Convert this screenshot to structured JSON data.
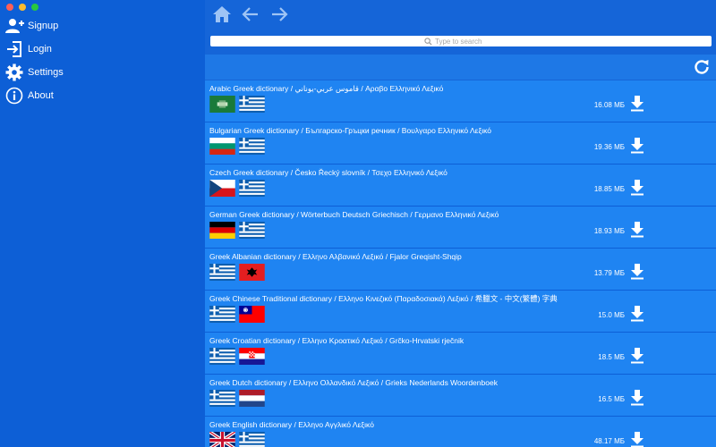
{
  "sidebar": {
    "items": [
      {
        "label": "Signup",
        "icon": "add-user-icon"
      },
      {
        "label": "Login",
        "icon": "login-icon"
      },
      {
        "label": "Settings",
        "icon": "gear-icon"
      },
      {
        "label": "About",
        "icon": "info-icon"
      }
    ]
  },
  "search": {
    "placeholder": "Type to search"
  },
  "dictionaries": [
    {
      "title": "Arabic Greek dictionary / قاموس عربي-يوناني / Αραβο Ελληνικό Λεξικό",
      "size": "16.08 МБ",
      "flags": [
        "saudi-arabia",
        "greece"
      ]
    },
    {
      "title": "Bulgarian Greek dictionary / Българско-Гръцки речник / Βουλγαρο Ελληνικό Λεξικό",
      "size": "19.36 МБ",
      "flags": [
        "bulgaria",
        "greece"
      ]
    },
    {
      "title": "Czech Greek dictionary / Česko Řecký slovník / Τσεχο Ελληνικό Λεξικό",
      "size": "18.85 МБ",
      "flags": [
        "czech-republic",
        "greece"
      ]
    },
    {
      "title": "German Greek dictionary / Wörterbuch Deutsch Griechisch / Γερμανο Ελληνικό Λεξικό",
      "size": "18.93 МБ",
      "flags": [
        "germany",
        "greece"
      ]
    },
    {
      "title": "Greek Albanian dictionary / Ελληνο Αλβανικό Λεξικό / Fjalor Greqisht-Shqip",
      "size": "13.79 МБ",
      "flags": [
        "greece",
        "albania"
      ]
    },
    {
      "title": "Greek Chinese Traditional dictionary / Ελληνο Κινεζικό (Παραδοσιακά) Λεξικό / 希臘文 - 中文(繁體) 字典",
      "size": "15.0 МБ",
      "flags": [
        "greece",
        "taiwan"
      ]
    },
    {
      "title": "Greek Croatian dictionary / Ελληνο Κροατικό Λεξικό / Grčko-Hrvatski rječnik",
      "size": "18.5 МБ",
      "flags": [
        "greece",
        "croatia"
      ]
    },
    {
      "title": "Greek Dutch dictionary / Ελληνο Ολλανδικό Λεξικό / Grieks Nederlands Woordenboek",
      "size": "16.5 МБ",
      "flags": [
        "greece",
        "netherlands"
      ]
    },
    {
      "title": "Greek English dictionary / Ελληνο Αγγλικό Λεξικό",
      "size": "48.17 МБ",
      "flags": [
        "united-kingdom",
        "greece"
      ]
    }
  ]
}
